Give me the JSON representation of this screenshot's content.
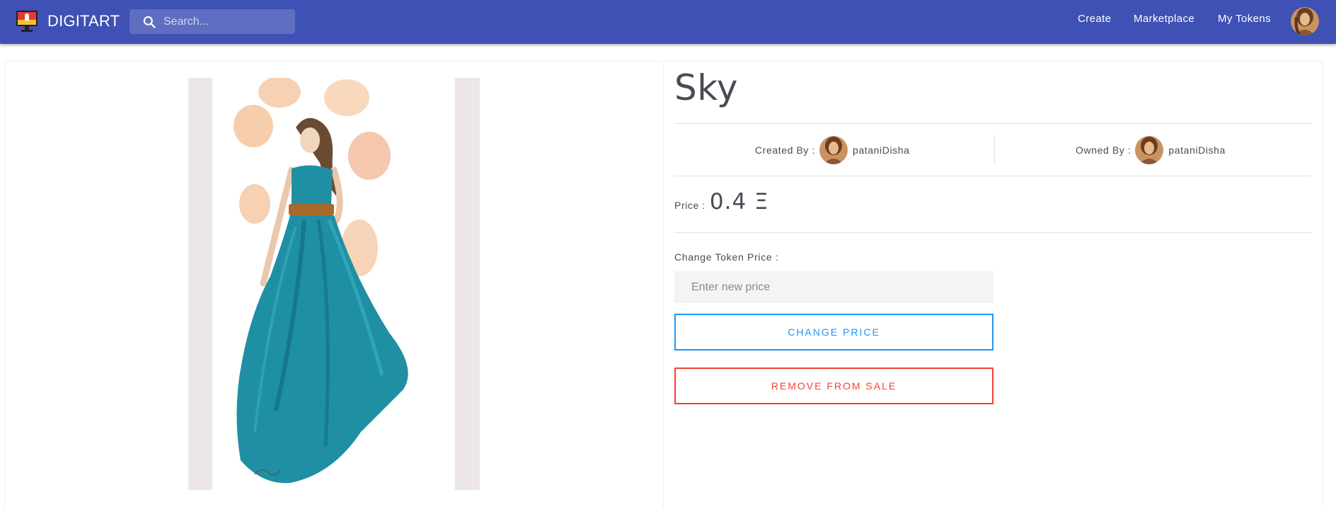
{
  "header": {
    "brand": "DIGITART",
    "search_placeholder": "Search...",
    "nav": {
      "create": "Create",
      "marketplace": "Marketplace",
      "my_tokens": "My Tokens"
    }
  },
  "token": {
    "title": "Sky",
    "created_by_label": "Created By :",
    "creator": "pataniDisha",
    "owned_by_label": "Owned By :",
    "owner": "pataniDisha",
    "price_label": "Price :",
    "price_value": "0.4 Ξ"
  },
  "form": {
    "change_label": "Change Token Price :",
    "input_placeholder": "Enter new price",
    "change_button": "CHANGE PRICE",
    "remove_button": "REMOVE FROM SALE"
  },
  "colors": {
    "appbar": "#3f51b5",
    "change_accent": "#2196f3",
    "remove_accent": "#f44336",
    "dress": "#1f8fa4"
  },
  "icons": {
    "logo": "monitor-logo-icon",
    "search": "search-icon"
  }
}
